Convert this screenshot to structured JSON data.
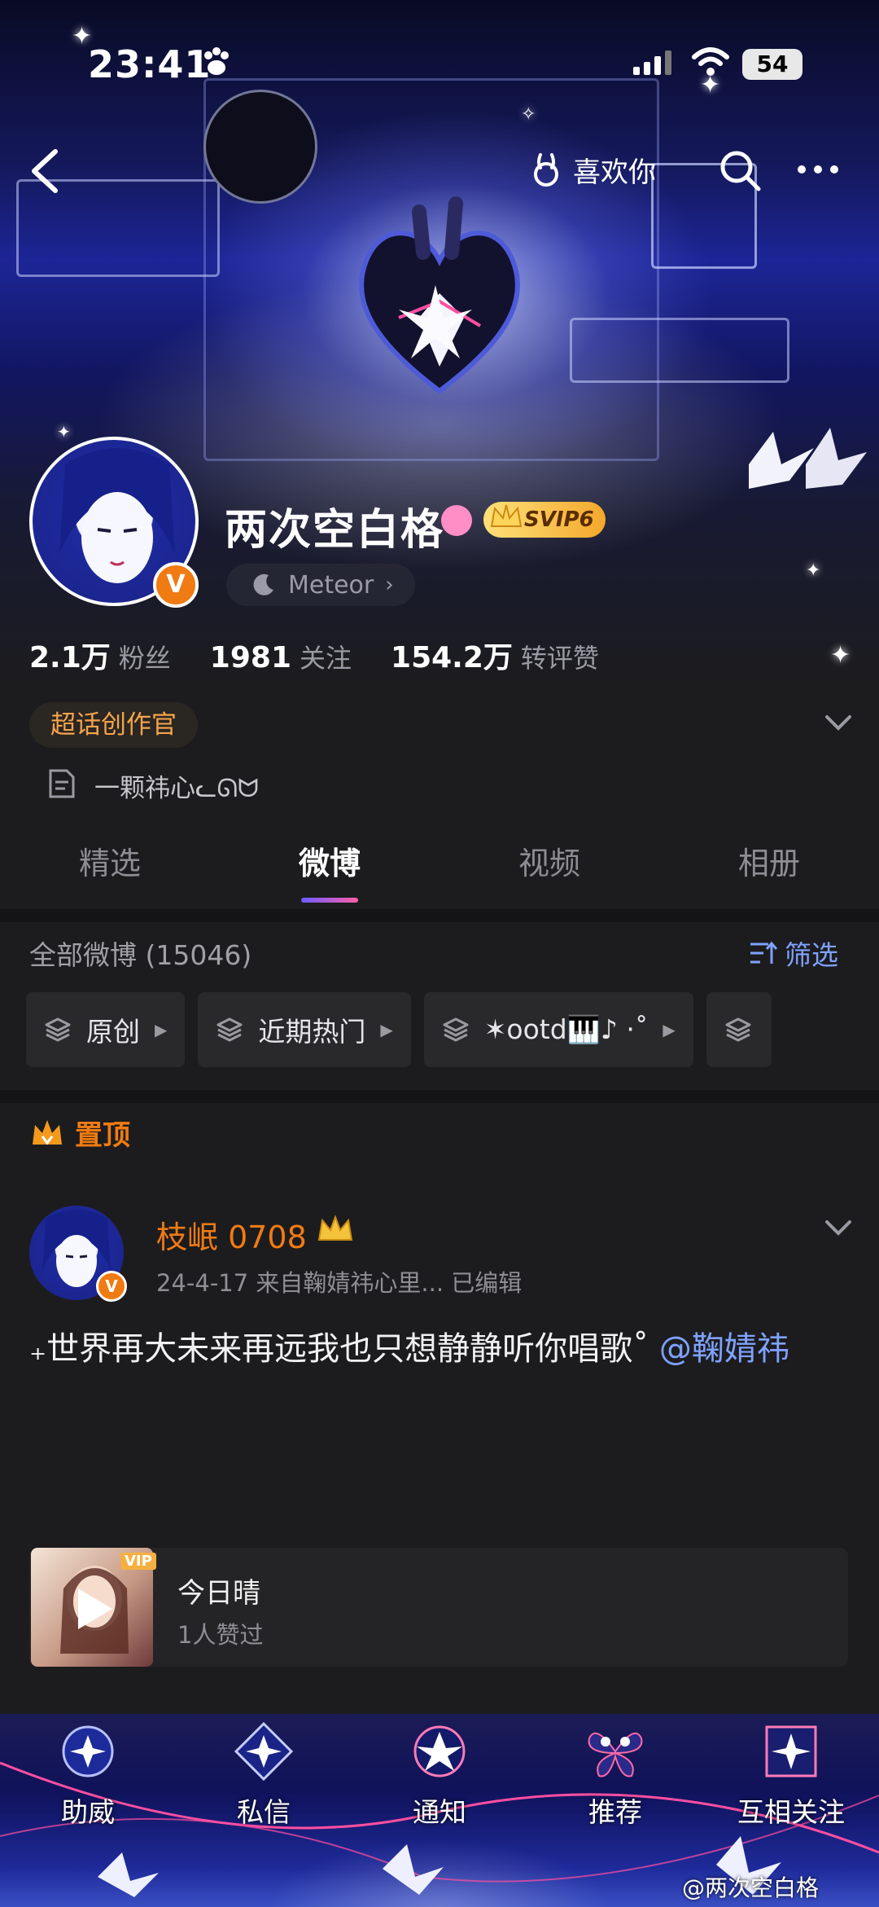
{
  "status_bar": {
    "time": "23:41",
    "battery": "54"
  },
  "header": {
    "like_label": "喜欢你"
  },
  "profile": {
    "username": "两次空白格",
    "svip": "SVIP6",
    "badge_letter": "V",
    "meteor_label": "Meteor",
    "stats": [
      {
        "num": "2.1万",
        "label": "粉丝"
      },
      {
        "num": "1981",
        "label": "关注"
      },
      {
        "num": "154.2万",
        "label": "转评赞"
      }
    ],
    "topic_badge": "超话创作官",
    "bio": "一颗祎心ᓚᘏᗢ"
  },
  "tabs": [
    {
      "label": "精选"
    },
    {
      "label": "微博"
    },
    {
      "label": "视频"
    },
    {
      "label": "相册"
    }
  ],
  "feed": {
    "all_label": "全部微博 (15046)",
    "filter_label": "筛选",
    "chips": [
      {
        "label": "原创"
      },
      {
        "label": "近期热门"
      },
      {
        "label": "✶ootd🎹♪ ·˚"
      }
    ]
  },
  "pinned": {
    "label": "置顶",
    "author": "枝岷 0708",
    "meta": "24-4-17  来自鞠婧祎心里...  已编辑",
    "text": "₊世界再大未来再远我也只想静静听你唱歌˚ ",
    "mention": "@鞠婧祎",
    "music": {
      "vip": "VIP",
      "title": "今日晴",
      "subtitle": "1人赞过"
    }
  },
  "bottom_nav": [
    {
      "label": "助威",
      "icon": "moon-flower-icon"
    },
    {
      "label": "私信",
      "icon": "star-flower-icon"
    },
    {
      "label": "通知",
      "icon": "lily-icon"
    },
    {
      "label": "推荐",
      "icon": "butterfly-icon"
    },
    {
      "label": "互相关注",
      "icon": "frame-flower-icon"
    }
  ],
  "watermark": "@两次空白格",
  "colors": {
    "accent_orange": "#f07b12",
    "link_blue": "#7fa2ff",
    "background": "#1c1c1e"
  }
}
